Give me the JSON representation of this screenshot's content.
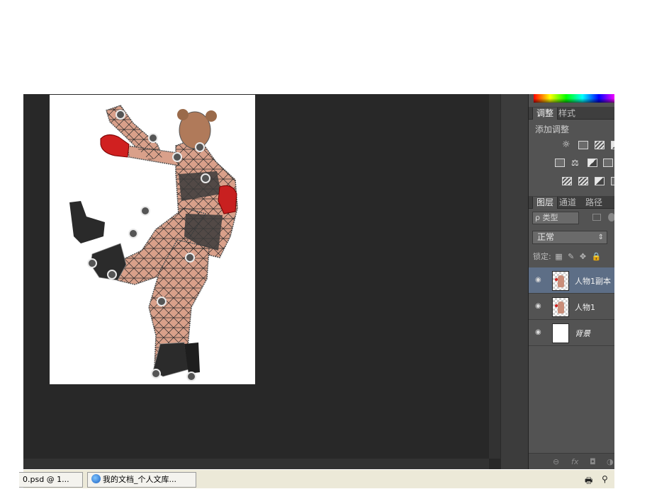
{
  "panels": {
    "adjust_tabs": [
      {
        "label": "调整",
        "active": true
      },
      {
        "label": "样式",
        "active": false
      }
    ],
    "adjust_title": "添加调整",
    "adjust_icons": [
      "brightness-icon",
      "levels-icon",
      "curves-icon",
      "exposure-icon",
      "vibrance-icon",
      "balance-icon",
      "bw-icon",
      "photo-filter-icon",
      "invert-icon",
      "posterize-icon",
      "threshold-icon",
      "gradient-map-icon"
    ],
    "layer_tabs": [
      {
        "label": "图层",
        "active": true
      },
      {
        "label": "通道",
        "active": false
      },
      {
        "label": "路径",
        "active": false
      }
    ],
    "filter_kind": "ρ 类型",
    "blend_mode": "正常",
    "lock_label": "锁定:",
    "layers": [
      {
        "name": "人物1副本",
        "selected": true,
        "thumb": "figure"
      },
      {
        "name": "人物1",
        "selected": false,
        "thumb": "figure"
      },
      {
        "name": "背景",
        "selected": false,
        "thumb": "white",
        "italic": true
      }
    ]
  },
  "taskbar": {
    "items": [
      {
        "label": "0.psd @ 1...",
        "icon": "ps"
      },
      {
        "label": "我的文档_个人文库...",
        "icon": "ie-icon"
      }
    ]
  },
  "colors": {
    "workspace": "#282828",
    "panel_bg": "#535353",
    "selected_layer": "#5d6e86",
    "glove_red": "#d02020"
  }
}
